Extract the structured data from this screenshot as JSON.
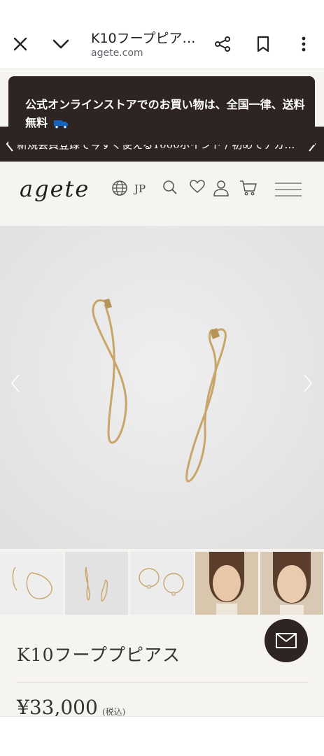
{
  "browser": {
    "page_title": "K10フープピア…",
    "url": "agete.com"
  },
  "banner": {
    "shipping_text": "公式オンラインストアでのお買い物は、全国一律、送料無料",
    "promo_text": "新規会員登録で今すぐ使える1000ポイント / 初めてアガ…"
  },
  "header": {
    "logo": "agete",
    "region": "JP"
  },
  "product": {
    "title": "K10フーププピアス",
    "price": "¥33,000",
    "tax_note": "(税込)"
  },
  "colors": {
    "brand_dark": "#2e2522",
    "page_bg": "#f6f4f0",
    "hero_bg": "#e8e8e8",
    "gold": "#c9a56a",
    "truck_blue": "#1565c0"
  },
  "icons": [
    "close-icon",
    "chevron-down-icon",
    "share-icon",
    "bookmark-icon",
    "more-vert-icon",
    "globe-icon",
    "search-icon",
    "heart-icon",
    "user-icon",
    "cart-icon",
    "menu-icon",
    "mail-icon",
    "truck-icon"
  ]
}
